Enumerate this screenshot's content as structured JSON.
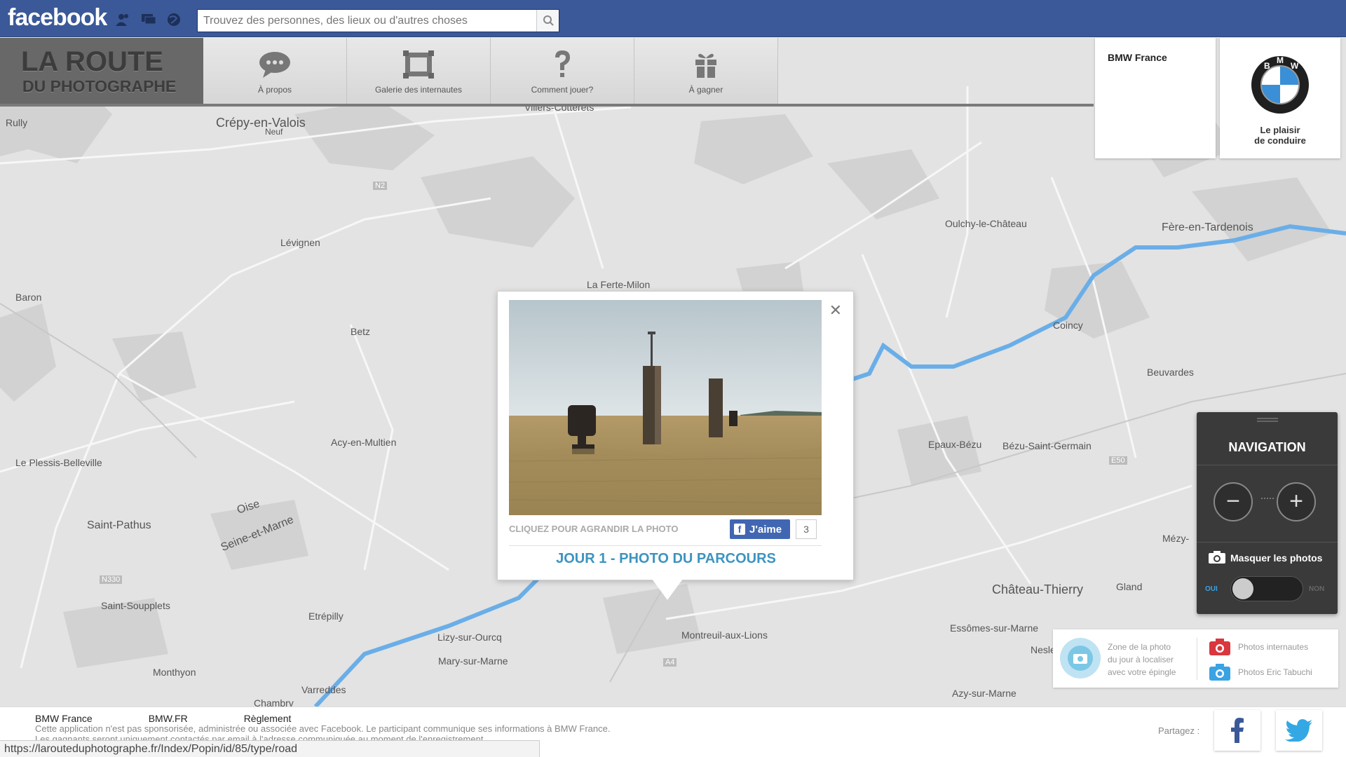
{
  "facebook": {
    "logo": "facebook",
    "search_placeholder": "Trouvez des personnes, des lieux ou d'autres choses"
  },
  "app": {
    "logo_line1": "LA ROUTE",
    "logo_line2": "DU PHOTOGRAPHE",
    "nav": [
      {
        "label": "À propos",
        "icon": "speech-bubble-icon"
      },
      {
        "label": "Galerie des internautes",
        "icon": "gallery-frame-icon"
      },
      {
        "label": "Comment jouer?",
        "icon": "question-mark-icon"
      },
      {
        "label": "À gagner",
        "icon": "gift-icon"
      }
    ],
    "brand_page": "BMW France",
    "bmw_tagline_1": "Le plaisir",
    "bmw_tagline_2": "de conduire"
  },
  "map": {
    "places": [
      {
        "name": "Rully"
      },
      {
        "name": "Crépy-en-Valois"
      },
      {
        "name": "Villers-Cotterets"
      },
      {
        "name": "Lévignen"
      },
      {
        "name": "Baron"
      },
      {
        "name": "Betz"
      },
      {
        "name": "La Ferte-Milon"
      },
      {
        "name": "Acy-en-Multien"
      },
      {
        "name": "Le Plessis-Belleville"
      },
      {
        "name": "Oise"
      },
      {
        "name": "Seine-et-Marne"
      },
      {
        "name": "Saint-Pathus"
      },
      {
        "name": "Saint-Soupplets"
      },
      {
        "name": "Etrépilly"
      },
      {
        "name": "Lizy-sur-Ourcq"
      },
      {
        "name": "Mary-sur-Marne"
      },
      {
        "name": "Monthyon"
      },
      {
        "name": "Varreddes"
      },
      {
        "name": "Chambry"
      },
      {
        "name": "Montreuil-aux-Lions"
      },
      {
        "name": "Oulchy-le-Château"
      },
      {
        "name": "Fère-en-Tardenois"
      },
      {
        "name": "Coincy"
      },
      {
        "name": "Beuvardes"
      },
      {
        "name": "Epaux-Bézu"
      },
      {
        "name": "Bézu-Saint-Germain"
      },
      {
        "name": "Château-Thierry"
      },
      {
        "name": "Gland"
      },
      {
        "name": "Essômes-sur-Marne"
      },
      {
        "name": "Azy-sur-Marne"
      },
      {
        "name": "Mézy-"
      },
      {
        "name": "Nesle"
      },
      {
        "name": "Neuf"
      }
    ],
    "roads": [
      "N2",
      "E50",
      "A4",
      "N330"
    ]
  },
  "popup": {
    "hint": "CLIQUEZ POUR AGRANDIR LA PHOTO",
    "like_label": "J'aime",
    "like_count": "3",
    "title": "JOUR 1 - PHOTO DU PARCOURS"
  },
  "navigation": {
    "title": "NAVIGATION",
    "zoom_out": "−",
    "zoom_in": "+",
    "hide_photos": "Masquer les photos",
    "toggle_on": "OUI",
    "toggle_off": "NON"
  },
  "legend": {
    "zone_line1": "Zone de la photo",
    "zone_line2": "du jour à localiser",
    "zone_line3": "avec votre épingle",
    "internautes": "Photos internautes",
    "tabuchi": "Photos Eric Tabuchi",
    "colors": {
      "internautes": "#d9363e",
      "tabuchi": "#3aa3e3"
    }
  },
  "footer": {
    "links": [
      "BMW France",
      "BMW.FR",
      "Règlement"
    ],
    "legal_1": "Cette application n'est pas sponsorisée, administrée ou associée avec Facebook. Le participant communique ses informations à BMW France.",
    "legal_2": "Les gagnants seront uniquement contactés par email à l'adresse communiquée au moment de l'enregistrement.",
    "share": "Partagez :"
  },
  "status_url": "https://larouteduphotographe.fr/Index/Popin/id/85/type/road",
  "colors": {
    "facebook_blue": "#3b5998",
    "river_blue": "#6aaee8",
    "title_blue": "#3c94c0"
  }
}
